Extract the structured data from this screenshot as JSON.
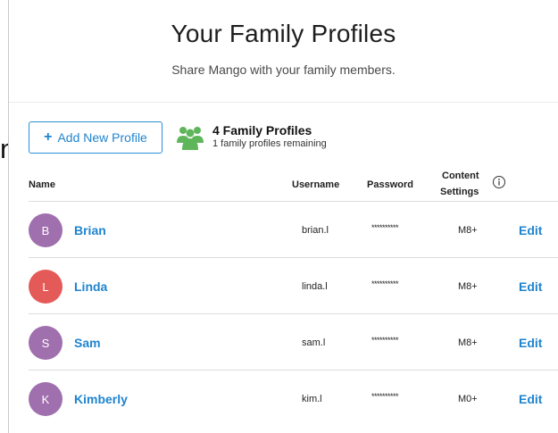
{
  "background": {
    "partial_text": "nal"
  },
  "modal": {
    "title": "Your Family Profiles",
    "subtitle": "Share Mango with your family members."
  },
  "toolbar": {
    "add_label": "Add New Profile",
    "family_count": "4 Family Profiles",
    "family_remaining": "1 family profiles remaining"
  },
  "table": {
    "headers": {
      "name": "Name",
      "username": "Username",
      "password": "Password",
      "content_line1": "Content",
      "content_line2": "Settings"
    },
    "rows": [
      {
        "initial": "B",
        "name": "Brian",
        "username": "brian.l",
        "password": "**********",
        "content": "M8+",
        "edit": "Edit",
        "avatar_color": "#a06fae"
      },
      {
        "initial": "L",
        "name": "Linda",
        "username": "linda.l",
        "password": "**********",
        "content": "M8+",
        "edit": "Edit",
        "avatar_color": "#e45a58"
      },
      {
        "initial": "S",
        "name": "Sam",
        "username": "sam.l",
        "password": "**********",
        "content": "M8+",
        "edit": "Edit",
        "avatar_color": "#a06fae"
      },
      {
        "initial": "K",
        "name": "Kimberly",
        "username": "kim.l",
        "password": "**********",
        "content": "M0+",
        "edit": "Edit",
        "avatar_color": "#a06fae"
      }
    ]
  },
  "colors": {
    "accent": "#1f84cf",
    "family_icon": "#5fb55a"
  },
  "icons": {
    "add": "plus-icon",
    "family": "family-group-icon",
    "info": "info-icon"
  }
}
